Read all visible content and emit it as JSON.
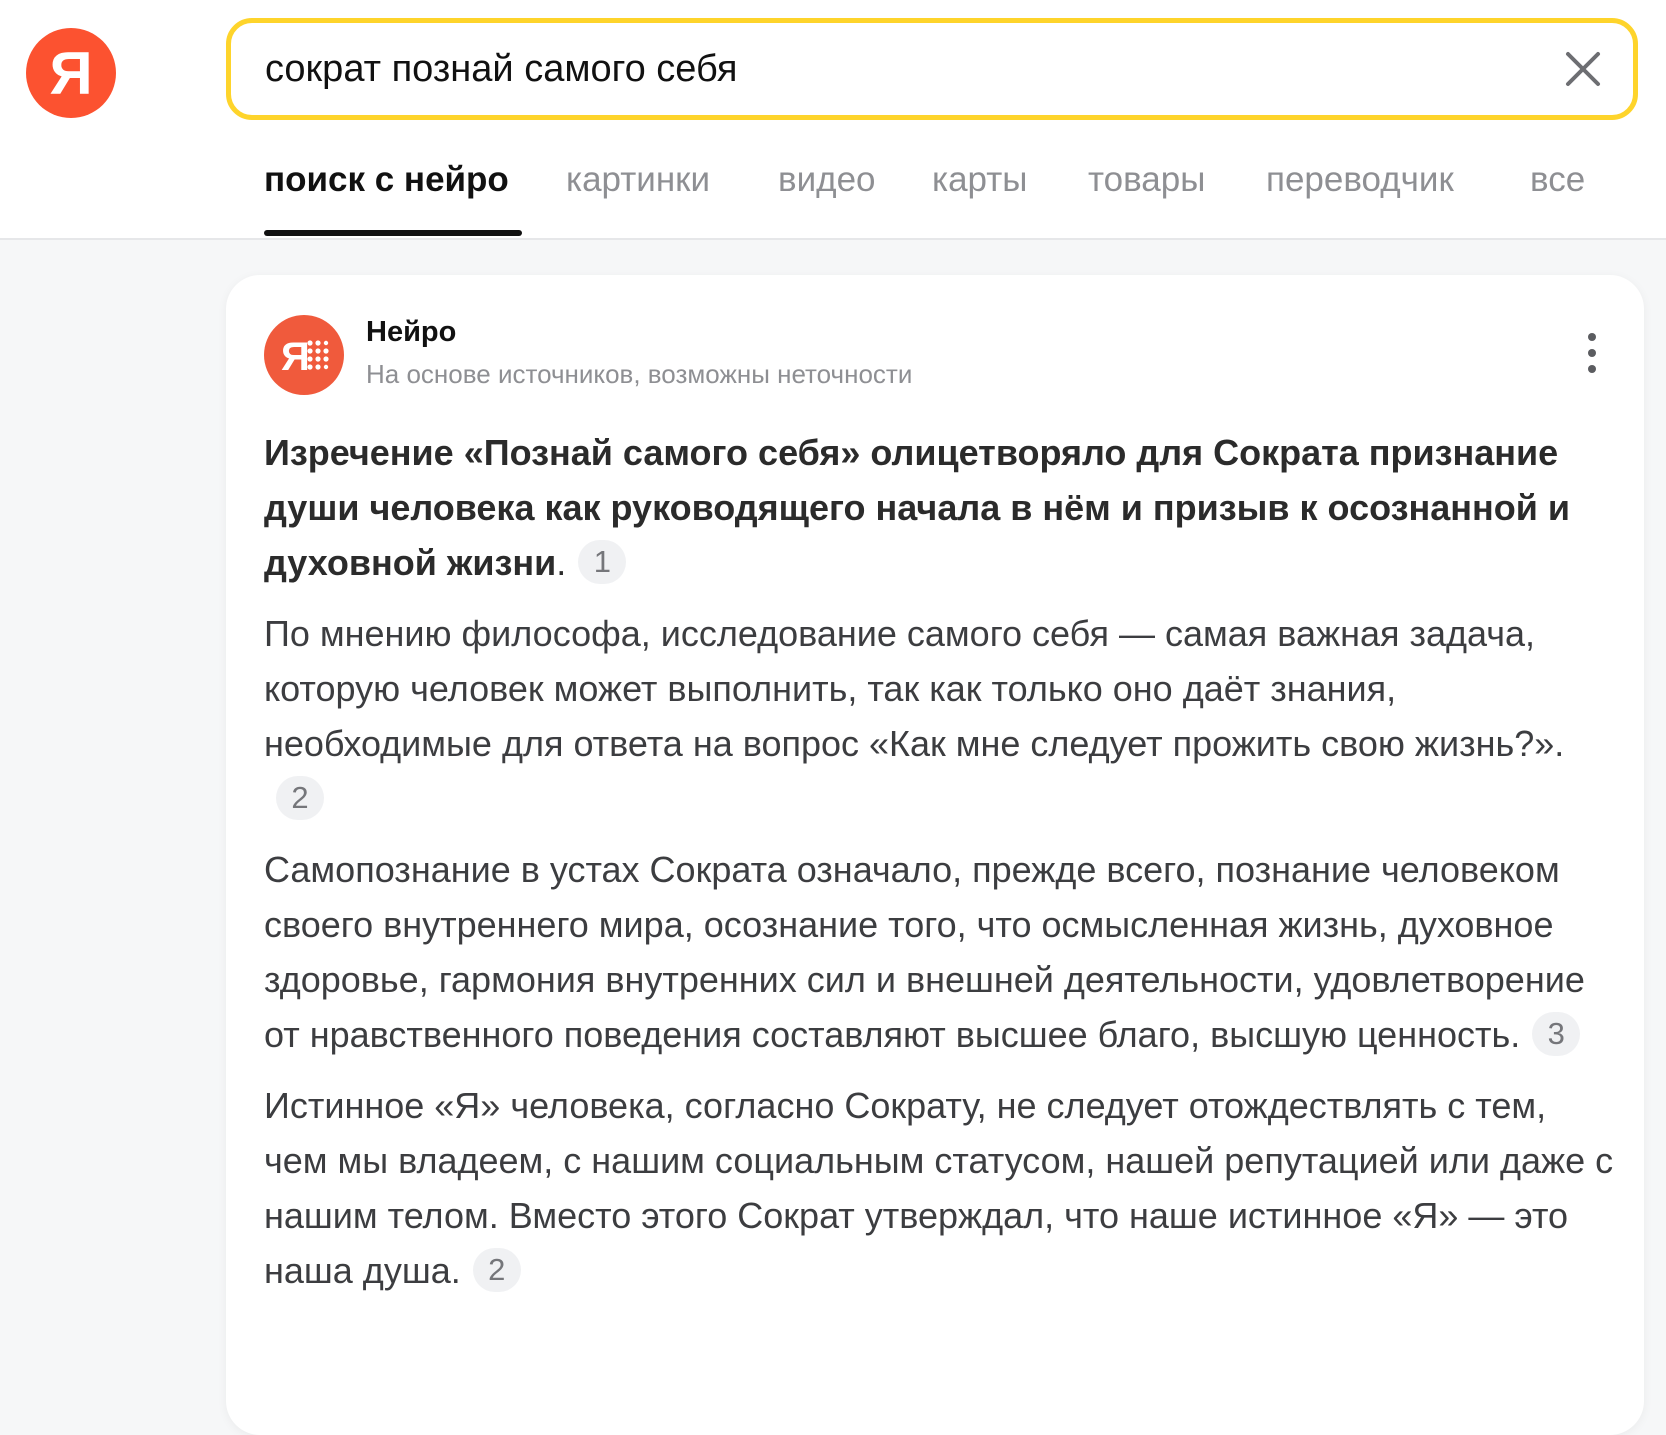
{
  "logo": {
    "letter": "Я"
  },
  "search": {
    "query": "сократ познай самого себя"
  },
  "tabs": [
    {
      "label": "поиск с нейро",
      "active": true
    },
    {
      "label": "картинки",
      "active": false
    },
    {
      "label": "видео",
      "active": false
    },
    {
      "label": "карты",
      "active": false
    },
    {
      "label": "товары",
      "active": false
    },
    {
      "label": "переводчик",
      "active": false
    },
    {
      "label": "все",
      "active": false
    }
  ],
  "neiro": {
    "title": "Нейро",
    "subtitle": "На основе источников, возможны неточности"
  },
  "answer": {
    "lead_bold": "Изречение «Познай самого себя» олицетворяло для Сократа признание души человека как руководящего начала в нём и призыв к осознанной и духовной жизни",
    "lead_tail": ".",
    "lead_ref": "1",
    "paragraphs": [
      {
        "text": "По мнению философа, исследование самого себя — самая важная задача, которую человек может выполнить, так как только оно даёт знания, необходимые для ответа на вопрос «Как мне следует прожить свою жизнь?».",
        "ref": "2"
      },
      {
        "text": "Самопознание в устах Сократа означало, прежде всего, познание человеком своего внутреннего мира, осознание того, что осмысленная жизнь, духовное здоровье, гармония внутренних сил и внешней деятельности, удовлетворение от нравственного поведения составляют высшее благо, высшую ценность.",
        "ref": "3"
      },
      {
        "text": "Истинное «Я» человека, согласно Сократу, не следует отождествлять с тем, чем мы владеем, с нашим социальным статусом, нашей репутацией или даже с нашим телом. Вместо этого Сократ утверждал, что наше истинное «Я» — это наша душа.",
        "ref": "2"
      }
    ]
  },
  "colors": {
    "brand_red": "#fc5230",
    "search_border": "#fed42b",
    "tab_inactive": "#8e8f93",
    "neiro_avatar": "#f05a3c"
  },
  "icons": {
    "clear": "close-icon",
    "more": "more-vertical-icon",
    "neiro": "neiro-logo-icon"
  }
}
